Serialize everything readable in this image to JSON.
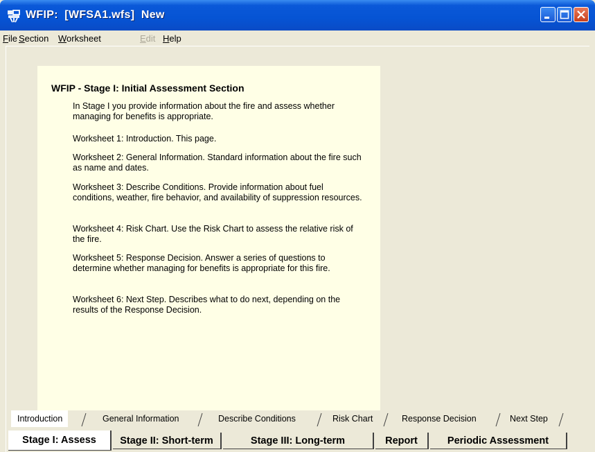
{
  "window": {
    "title": "WFIP:  [WFSA1.wfs]  New"
  },
  "menu": {
    "items": [
      {
        "label": "File",
        "disabled": false
      },
      {
        "label": "Section",
        "disabled": false
      },
      {
        "label": "Worksheet",
        "disabled": false
      },
      {
        "label": "Edit",
        "disabled": true
      },
      {
        "label": "Help",
        "disabled": false
      }
    ]
  },
  "content": {
    "heading": "WFIP - Stage I: Initial Assessment Section",
    "paragraphs": [
      "In Stage I you provide information about the fire and assess whether managing for benefits is appropriate.",
      "Worksheet 1: Introduction.  This page.",
      "Worksheet 2: General Information.  Standard information about the fire such as name and dates.",
      "Worksheet 3: Describe Conditions.  Provide information about fuel conditions, weather, fire behavior, and availability of suppression resources.",
      "Worksheet 4: Risk Chart.  Use the Risk Chart to assess the relative risk of the fire.",
      "Worksheet 5: Response Decision.  Answer a series of questions to determine whether managing for benefits is appropriate for this fire.",
      "Worksheet 6: Next Step.  Describes what to do next, depending on the results of the Response Decision."
    ]
  },
  "worksheet_tabs": [
    "Introduction",
    "General Information",
    "Describe Conditions",
    "Risk Chart",
    "Response Decision",
    "Next Step"
  ],
  "stage_tabs": [
    "Stage I: Assess",
    "Stage II: Short-term",
    "Stage III: Long-term",
    "Report",
    "Periodic Assessment"
  ],
  "colors": {
    "titlebar": "#0a58d8",
    "panel": "#ffffe6",
    "chrome": "#ece9d8",
    "close_button": "#d9532c"
  }
}
